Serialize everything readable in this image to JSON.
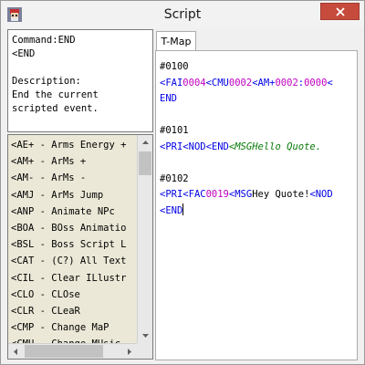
{
  "window": {
    "title": "Script",
    "app_icon": "app-character-icon",
    "close_icon": "close-icon"
  },
  "command_info": {
    "lines": [
      "Command:END",
      "<END",
      "",
      "Description:",
      "End the current",
      "scripted event."
    ]
  },
  "command_list": {
    "items": [
      "<AE+ - Arms Energy +",
      "<AM+ - ArMs +",
      "<AM- - ArMs -",
      "<AMJ - ArMs Jump",
      "<ANP - Animate NPc",
      "<BOA - BOss Animatio",
      "<BSL - Boss Script L",
      "<CAT - (C?) All Text",
      "<CIL - Clear ILlustr",
      "<CLO - CLOse",
      "<CLR - CLeaR",
      "<CMP - Change MaP",
      "<CMU - Change MUsic"
    ]
  },
  "tab": {
    "label": "T-Map"
  },
  "script": {
    "lines": [
      [
        {
          "t": "#0100",
          "c": "event-id"
        }
      ],
      [
        {
          "t": "<FAI",
          "c": "cmd"
        },
        {
          "t": "0004",
          "c": "num"
        },
        {
          "t": "<CMU",
          "c": "cmd"
        },
        {
          "t": "0002",
          "c": "num"
        },
        {
          "t": "<AM+",
          "c": "cmd"
        },
        {
          "t": "0002",
          "c": "num"
        },
        {
          "t": ":",
          "c": "cmd"
        },
        {
          "t": "0000",
          "c": "num"
        },
        {
          "t": "<",
          "c": "cmd"
        }
      ],
      [
        {
          "t": "END",
          "c": "cmd"
        }
      ],
      [],
      [
        {
          "t": "#0101",
          "c": "event-id"
        }
      ],
      [
        {
          "t": "<PRI",
          "c": "cmd"
        },
        {
          "t": "<NOD",
          "c": "cmd"
        },
        {
          "t": "<END",
          "c": "cmd"
        },
        {
          "t": "<MSG",
          "c": "msg"
        },
        {
          "t": "Hello Quote.",
          "c": "msg"
        }
      ],
      [],
      [
        {
          "t": "#0102",
          "c": "event-id"
        }
      ],
      [
        {
          "t": "<PRI",
          "c": "cmd"
        },
        {
          "t": "<FAC",
          "c": "cmd"
        },
        {
          "t": "0019",
          "c": "num"
        },
        {
          "t": "<MSG",
          "c": "cmd"
        },
        {
          "t": "Hey Quote!",
          "c": "event-id"
        },
        {
          "t": "<NOD",
          "c": "cmd"
        }
      ],
      [
        {
          "t": "<END",
          "c": "cmd",
          "caret": true
        }
      ]
    ]
  },
  "scrollbars": {
    "up": "arrow-up-icon",
    "down": "arrow-down-icon",
    "left": "arrow-left-icon",
    "right": "arrow-right-icon"
  }
}
